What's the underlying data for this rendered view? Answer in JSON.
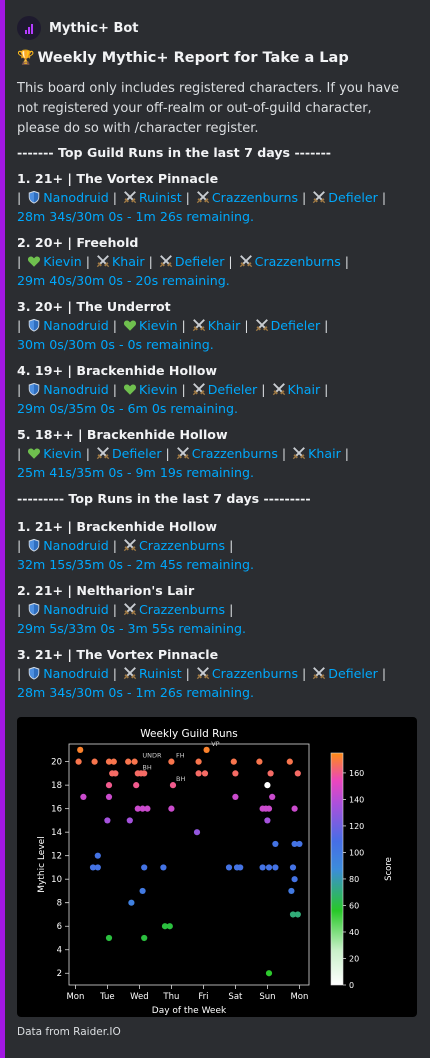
{
  "bot": {
    "name": "Mythic+ Bot",
    "icon": "chart-bars-icon"
  },
  "embed": {
    "accent": "#a317e3",
    "title": "Weekly Mythic+ Report for Take a Lap",
    "title_icon": "trophy-icon",
    "description": "This board only includes registered characters. If you have not registered your off-realm or out-of-guild character, please do so with /character register.",
    "guild_header": "------- Top Guild Runs in the last 7 days -------",
    "top_header": "--------- Top Runs in the last 7 days ---------",
    "footer": "Data from Raider.IO"
  },
  "guild_runs": [
    {
      "title": "1.  21+ | The Vortex Pinnacle",
      "members": [
        {
          "icon": "shield-icon",
          "name": "Nanodruid"
        },
        {
          "icon": "crossed-swords-icon",
          "name": "Ruinist"
        },
        {
          "icon": "crossed-swords-icon",
          "name": "Crazzenburns"
        },
        {
          "icon": "crossed-swords-icon",
          "name": "Defieler"
        }
      ],
      "time": "28m 34s/30m 0s - 1m 26s remaining."
    },
    {
      "title": "2.  20+ | Freehold",
      "members": [
        {
          "icon": "heart-icon",
          "name": "Kievin"
        },
        {
          "icon": "crossed-swords-icon",
          "name": "Khair"
        },
        {
          "icon": "crossed-swords-icon",
          "name": "Defieler"
        },
        {
          "icon": "crossed-swords-icon",
          "name": "Crazzenburns"
        }
      ],
      "time": "29m 40s/30m 0s - 20s remaining."
    },
    {
      "title": "3.  20+ | The Underrot",
      "members": [
        {
          "icon": "shield-icon",
          "name": "Nanodruid"
        },
        {
          "icon": "heart-icon",
          "name": "Kievin"
        },
        {
          "icon": "crossed-swords-icon",
          "name": "Khair"
        },
        {
          "icon": "crossed-swords-icon",
          "name": "Defieler"
        }
      ],
      "time": "30m 0s/30m 0s - 0s remaining."
    },
    {
      "title": "4.  19+ | Brackenhide Hollow",
      "members": [
        {
          "icon": "shield-icon",
          "name": "Nanodruid"
        },
        {
          "icon": "heart-icon",
          "name": "Kievin"
        },
        {
          "icon": "crossed-swords-icon",
          "name": "Defieler"
        },
        {
          "icon": "crossed-swords-icon",
          "name": "Khair"
        }
      ],
      "time": "29m 0s/35m 0s - 6m 0s remaining."
    },
    {
      "title": "5.  18++ | Brackenhide Hollow",
      "members": [
        {
          "icon": "heart-icon",
          "name": "Kievin"
        },
        {
          "icon": "crossed-swords-icon",
          "name": "Defieler"
        },
        {
          "icon": "crossed-swords-icon",
          "name": "Crazzenburns"
        },
        {
          "icon": "crossed-swords-icon",
          "name": "Khair"
        }
      ],
      "time": "25m 41s/35m 0s - 9m 19s remaining."
    }
  ],
  "top_runs": [
    {
      "title": "1.  21+ | Brackenhide Hollow",
      "members": [
        {
          "icon": "shield-icon",
          "name": "Nanodruid"
        },
        {
          "icon": "crossed-swords-icon",
          "name": "Crazzenburns"
        }
      ],
      "time": "32m 15s/35m 0s - 2m 45s remaining."
    },
    {
      "title": "2.  21+ | Neltharion's Lair",
      "members": [
        {
          "icon": "shield-icon",
          "name": "Nanodruid"
        },
        {
          "icon": "crossed-swords-icon",
          "name": "Crazzenburns"
        }
      ],
      "time": "29m 5s/33m 0s - 3m 55s remaining."
    },
    {
      "title": "3.  21+ | The Vortex Pinnacle",
      "members": [
        {
          "icon": "shield-icon",
          "name": "Nanodruid"
        },
        {
          "icon": "crossed-swords-icon",
          "name": "Ruinist"
        },
        {
          "icon": "crossed-swords-icon",
          "name": "Crazzenburns"
        },
        {
          "icon": "crossed-swords-icon",
          "name": "Defieler"
        }
      ],
      "time": "28m 34s/30m 0s - 1m 26s remaining."
    }
  ],
  "colors": {
    "link": "#00a8fc",
    "tank": "#3b82d6",
    "healer": "#6fc04e",
    "dps": "#c9b28a"
  },
  "chart_data": {
    "type": "scatter",
    "title": "Weekly Guild Runs",
    "xlabel": "Day of the Week",
    "ylabel": "Mythic Level",
    "x_categories": [
      "Mon",
      "Tue",
      "Wed",
      "Thu",
      "Fri",
      "Sat",
      "Sun",
      "Mon"
    ],
    "xlim": [
      -0.2,
      7.3
    ],
    "ylim": [
      1,
      21.5
    ],
    "yticks": [
      2,
      4,
      6,
      8,
      10,
      12,
      14,
      16,
      18,
      20
    ],
    "colorbar": {
      "label": "Score",
      "range": [
        0,
        175
      ],
      "ticks": [
        0,
        20,
        40,
        60,
        80,
        100,
        120,
        140,
        160
      ],
      "colormap": "gist_ncar-like (white→green→blue→magenta→orange)"
    },
    "points": [
      {
        "x": 0.15,
        "y": 21,
        "score": 172
      },
      {
        "x": 0.1,
        "y": 20,
        "score": 168
      },
      {
        "x": 0.6,
        "y": 20,
        "score": 168
      },
      {
        "x": 0.25,
        "y": 17,
        "score": 145
      },
      {
        "x": 0.55,
        "y": 11,
        "score": 105
      },
      {
        "x": 0.7,
        "y": 11,
        "score": 105
      },
      {
        "x": 0.7,
        "y": 12,
        "score": 105
      },
      {
        "x": 1.05,
        "y": 20,
        "score": 168
      },
      {
        "x": 1.2,
        "y": 20,
        "score": 168
      },
      {
        "x": 1.15,
        "y": 19,
        "score": 165
      },
      {
        "x": 1.25,
        "y": 19,
        "score": 165
      },
      {
        "x": 1.05,
        "y": 18,
        "score": 160
      },
      {
        "x": 1.05,
        "y": 17,
        "score": 145
      },
      {
        "x": 1.0,
        "y": 15,
        "score": 135
      },
      {
        "x": 1.05,
        "y": 5,
        "score": 60
      },
      {
        "x": 1.65,
        "y": 20,
        "score": 168
      },
      {
        "x": 1.85,
        "y": 20,
        "score": 168
      },
      {
        "x": 1.95,
        "y": 19,
        "score": 165
      },
      {
        "x": 2.05,
        "y": 19,
        "score": 165
      },
      {
        "x": 2.15,
        "y": 19,
        "score": 165
      },
      {
        "x": 1.9,
        "y": 18,
        "score": 160
      },
      {
        "x": 1.95,
        "y": 16,
        "score": 145
      },
      {
        "x": 2.1,
        "y": 16,
        "score": 145
      },
      {
        "x": 2.25,
        "y": 16,
        "score": 145
      },
      {
        "x": 1.7,
        "y": 15,
        "score": 135
      },
      {
        "x": 2.15,
        "y": 11,
        "score": 105
      },
      {
        "x": 2.1,
        "y": 9,
        "score": 100
      },
      {
        "x": 1.75,
        "y": 8,
        "score": 95
      },
      {
        "x": 2.15,
        "y": 5,
        "score": 60
      },
      {
        "x": 3.0,
        "y": 20,
        "score": 168
      },
      {
        "x": 3.05,
        "y": 18,
        "score": 160
      },
      {
        "x": 3.0,
        "y": 16,
        "score": 145
      },
      {
        "x": 2.75,
        "y": 11,
        "score": 105
      },
      {
        "x": 2.8,
        "y": 6,
        "score": 60
      },
      {
        "x": 2.95,
        "y": 6,
        "score": 60
      },
      {
        "x": 3.85,
        "y": 20,
        "score": 168
      },
      {
        "x": 3.85,
        "y": 19,
        "score": 165
      },
      {
        "x": 4.05,
        "y": 19,
        "score": 165
      },
      {
        "x": 4.1,
        "y": 21,
        "score": 172
      },
      {
        "x": 3.8,
        "y": 14,
        "score": 130
      },
      {
        "x": 4.95,
        "y": 20,
        "score": 168
      },
      {
        "x": 5.0,
        "y": 19,
        "score": 165
      },
      {
        "x": 5.0,
        "y": 17,
        "score": 145
      },
      {
        "x": 4.8,
        "y": 11,
        "score": 105
      },
      {
        "x": 5.05,
        "y": 11,
        "score": 105
      },
      {
        "x": 5.15,
        "y": 11,
        "score": 105
      },
      {
        "x": 5.75,
        "y": 20,
        "score": 168
      },
      {
        "x": 5.85,
        "y": 16,
        "score": 145
      },
      {
        "x": 5.95,
        "y": 16,
        "score": 145
      },
      {
        "x": 6.05,
        "y": 16,
        "score": 145
      },
      {
        "x": 6.0,
        "y": 15,
        "score": 135
      },
      {
        "x": 6.1,
        "y": 19,
        "score": 165
      },
      {
        "x": 6.15,
        "y": 17,
        "score": 145
      },
      {
        "x": 6.0,
        "y": 18,
        "score": 0
      },
      {
        "x": 5.85,
        "y": 11,
        "score": 105
      },
      {
        "x": 6.05,
        "y": 11,
        "score": 105
      },
      {
        "x": 6.25,
        "y": 13,
        "score": 105
      },
      {
        "x": 6.25,
        "y": 11,
        "score": 105
      },
      {
        "x": 6.05,
        "y": 2,
        "score": 55
      },
      {
        "x": 6.7,
        "y": 20,
        "score": 168
      },
      {
        "x": 6.95,
        "y": 19,
        "score": 165
      },
      {
        "x": 6.85,
        "y": 16,
        "score": 145
      },
      {
        "x": 6.85,
        "y": 13,
        "score": 105
      },
      {
        "x": 7.0,
        "y": 13,
        "score": 105
      },
      {
        "x": 6.8,
        "y": 11,
        "score": 105
      },
      {
        "x": 6.85,
        "y": 10,
        "score": 105
      },
      {
        "x": 6.75,
        "y": 9,
        "score": 100
      },
      {
        "x": 6.8,
        "y": 7,
        "score": 70
      },
      {
        "x": 6.95,
        "y": 7,
        "score": 70
      }
    ],
    "annotations": [
      {
        "text": "UNDR",
        "x": 2.0,
        "y": 20
      },
      {
        "text": "BH",
        "x": 2.0,
        "y": 19
      },
      {
        "text": "FH",
        "x": 3.05,
        "y": 20
      },
      {
        "text": "BH",
        "x": 3.05,
        "y": 18
      },
      {
        "text": "VP",
        "x": 4.15,
        "y": 21
      }
    ]
  }
}
